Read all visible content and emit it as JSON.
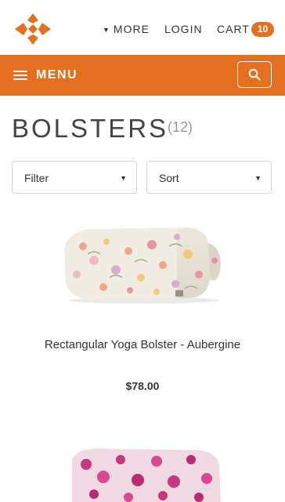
{
  "header": {
    "logo": "lotus-diamond-logo",
    "more_label": "MORE",
    "login_label": "LOGIN",
    "cart_label": "CART",
    "cart_count": "10"
  },
  "menu": {
    "label": "MENU",
    "search_icon": "search-icon"
  },
  "page": {
    "title": "BOLSTERS",
    "count": "(12)"
  },
  "controls": {
    "filter_label": "Filter",
    "sort_label": "Sort"
  },
  "products": [
    {
      "name": "Rectangular Yoga Bolster - Aubergine",
      "price": "$78.00"
    }
  ],
  "colors": {
    "accent": "#e2701f"
  }
}
